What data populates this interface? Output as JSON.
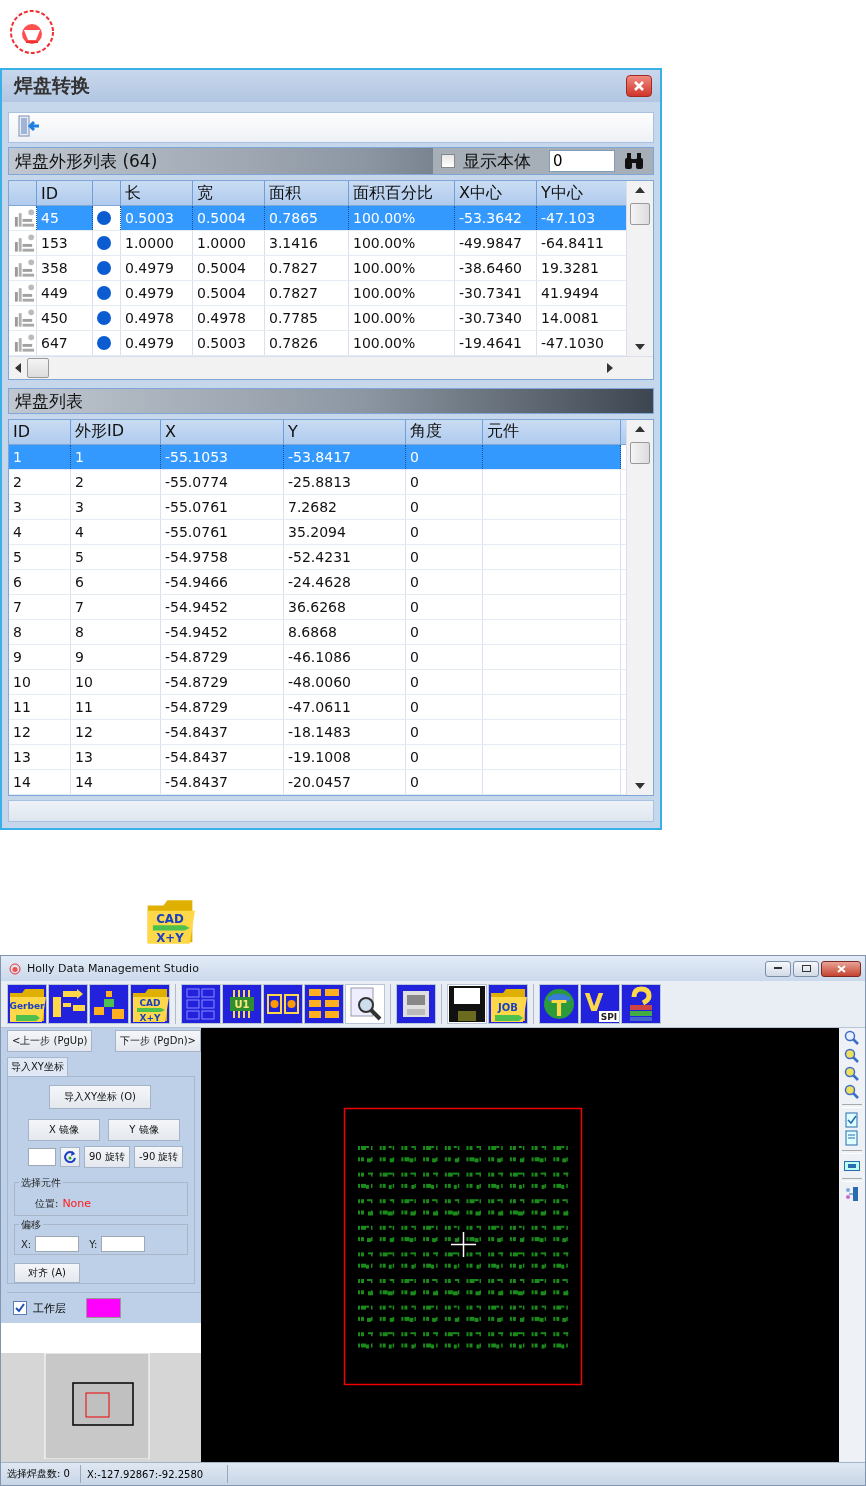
{
  "dialog": {
    "title": "焊盘转换",
    "shape_list": {
      "title": "焊盘外形列表 (64)",
      "show_body": {
        "label": "显示本体",
        "checked": false
      },
      "value": "0",
      "columns": [
        "ID",
        "长",
        "宽",
        "面积",
        "面积百分比",
        "X中心",
        "Y中心"
      ],
      "rows": [
        {
          "cells": [
            "45",
            "0.5003",
            "0.5004",
            "0.7865",
            "100.00%",
            "-53.3642",
            "-47.103"
          ],
          "selected": true
        },
        {
          "cells": [
            "153",
            "1.0000",
            "1.0000",
            "3.1416",
            "100.00%",
            "-49.9847",
            "-64.8411"
          ],
          "selected": false
        },
        {
          "cells": [
            "358",
            "0.4979",
            "0.5004",
            "0.7827",
            "100.00%",
            "-38.6460",
            "19.3281"
          ],
          "selected": false
        },
        {
          "cells": [
            "449",
            "0.4979",
            "0.5004",
            "0.7827",
            "100.00%",
            "-30.7341",
            "41.9494"
          ],
          "selected": false
        },
        {
          "cells": [
            "450",
            "0.4978",
            "0.4978",
            "0.7785",
            "100.00%",
            "-30.7340",
            "14.0081"
          ],
          "selected": false
        },
        {
          "cells": [
            "647",
            "0.4979",
            "0.5003",
            "0.7826",
            "100.00%",
            "-19.4641",
            "-47.1030"
          ],
          "selected": false
        }
      ]
    },
    "pad_list": {
      "title": "焊盘列表",
      "columns": [
        "ID",
        "外形ID",
        "X",
        "Y",
        "角度",
        "元件"
      ],
      "rows": [
        {
          "cells": [
            "1",
            "1",
            "-55.1053",
            "-53.8417",
            "0"
          ],
          "selected": true
        },
        {
          "cells": [
            "2",
            "2",
            "-55.0774",
            "-25.8813",
            "0"
          ],
          "selected": false
        },
        {
          "cells": [
            "3",
            "3",
            "-55.0761",
            "7.2682",
            "0"
          ],
          "selected": false
        },
        {
          "cells": [
            "4",
            "4",
            "-55.0761",
            "35.2094",
            "0"
          ],
          "selected": false
        },
        {
          "cells": [
            "5",
            "5",
            "-54.9758",
            "-52.4231",
            "0"
          ],
          "selected": false
        },
        {
          "cells": [
            "6",
            "6",
            "-54.9466",
            "-24.4628",
            "0"
          ],
          "selected": false
        },
        {
          "cells": [
            "7",
            "7",
            "-54.9452",
            "36.6268",
            "0"
          ],
          "selected": false
        },
        {
          "cells": [
            "8",
            "8",
            "-54.9452",
            "8.6868",
            "0"
          ],
          "selected": false
        },
        {
          "cells": [
            "9",
            "9",
            "-54.8729",
            "-46.1086",
            "0"
          ],
          "selected": false
        },
        {
          "cells": [
            "10",
            "10",
            "-54.8729",
            "-48.0060",
            "0"
          ],
          "selected": false
        },
        {
          "cells": [
            "11",
            "11",
            "-54.8729",
            "-47.0611",
            "0"
          ],
          "selected": false
        },
        {
          "cells": [
            "12",
            "12",
            "-54.8437",
            "-18.1483",
            "0"
          ],
          "selected": false
        },
        {
          "cells": [
            "13",
            "13",
            "-54.8437",
            "-19.1008",
            "0"
          ],
          "selected": false
        },
        {
          "cells": [
            "14",
            "14",
            "-54.8437",
            "-20.0457",
            "0"
          ],
          "selected": false
        }
      ]
    }
  },
  "cad_icon": {
    "texts": [
      "CAD",
      "X+Y"
    ]
  },
  "app": {
    "title": "Holly Data Management Studio",
    "toolbar": [
      [
        {
          "kind": "gerber",
          "texts": [
            "Gerber"
          ]
        },
        {
          "kind": "sequence"
        },
        {
          "kind": "parts"
        },
        {
          "kind": "cad",
          "texts": [
            "CAD",
            "X+Y"
          ]
        }
      ],
      [
        {
          "kind": "grid"
        },
        {
          "kind": "chip",
          "texts": [
            "U1"
          ]
        },
        {
          "kind": "pads"
        },
        {
          "kind": "padgrid"
        },
        {
          "kind": "search"
        }
      ],
      [
        {
          "kind": "machine"
        }
      ],
      [
        {
          "kind": "save"
        },
        {
          "kind": "job",
          "texts": [
            "JOB"
          ]
        }
      ],
      [
        {
          "kind": "globe",
          "texts": [
            "T"
          ]
        },
        {
          "kind": "spi",
          "texts": [
            "V",
            "SPI"
          ]
        },
        {
          "kind": "help"
        }
      ]
    ],
    "left_panel": {
      "prev": "<上一步 (PgUp)",
      "next": "下一步 (PgDn)>",
      "tab": "导入XY坐标",
      "import_button": "导入XY坐标 (O)",
      "mirror_x": "X 镜像",
      "mirror_y": "Y 镜像",
      "rotate_90": "90 旋转",
      "rotate_minus_90": "-90 旋转",
      "select_group": {
        "title": "选择元件",
        "position_label": "位置:",
        "position_value": "None"
      },
      "offset_group": {
        "title": "偏移",
        "x_label": "X:",
        "y_label": "Y:"
      },
      "align_button": "对齐 (A)",
      "work_layer": {
        "label": "工作层",
        "checked": true,
        "color": "#ff00ff"
      }
    },
    "side_toolbar": [
      [
        {
          "kind": "zoom"
        },
        {
          "kind": "zoom-in"
        },
        {
          "kind": "zoom-out"
        },
        {
          "kind": "zoom-fit"
        }
      ],
      [
        {
          "kind": "doc-check"
        },
        {
          "kind": "doc"
        }
      ],
      [
        {
          "kind": "board"
        }
      ],
      [
        {
          "kind": "layers"
        }
      ]
    ],
    "status_bar": [
      "选择焊盘数: 0",
      "X:-127.92867:-92.2580"
    ]
  }
}
